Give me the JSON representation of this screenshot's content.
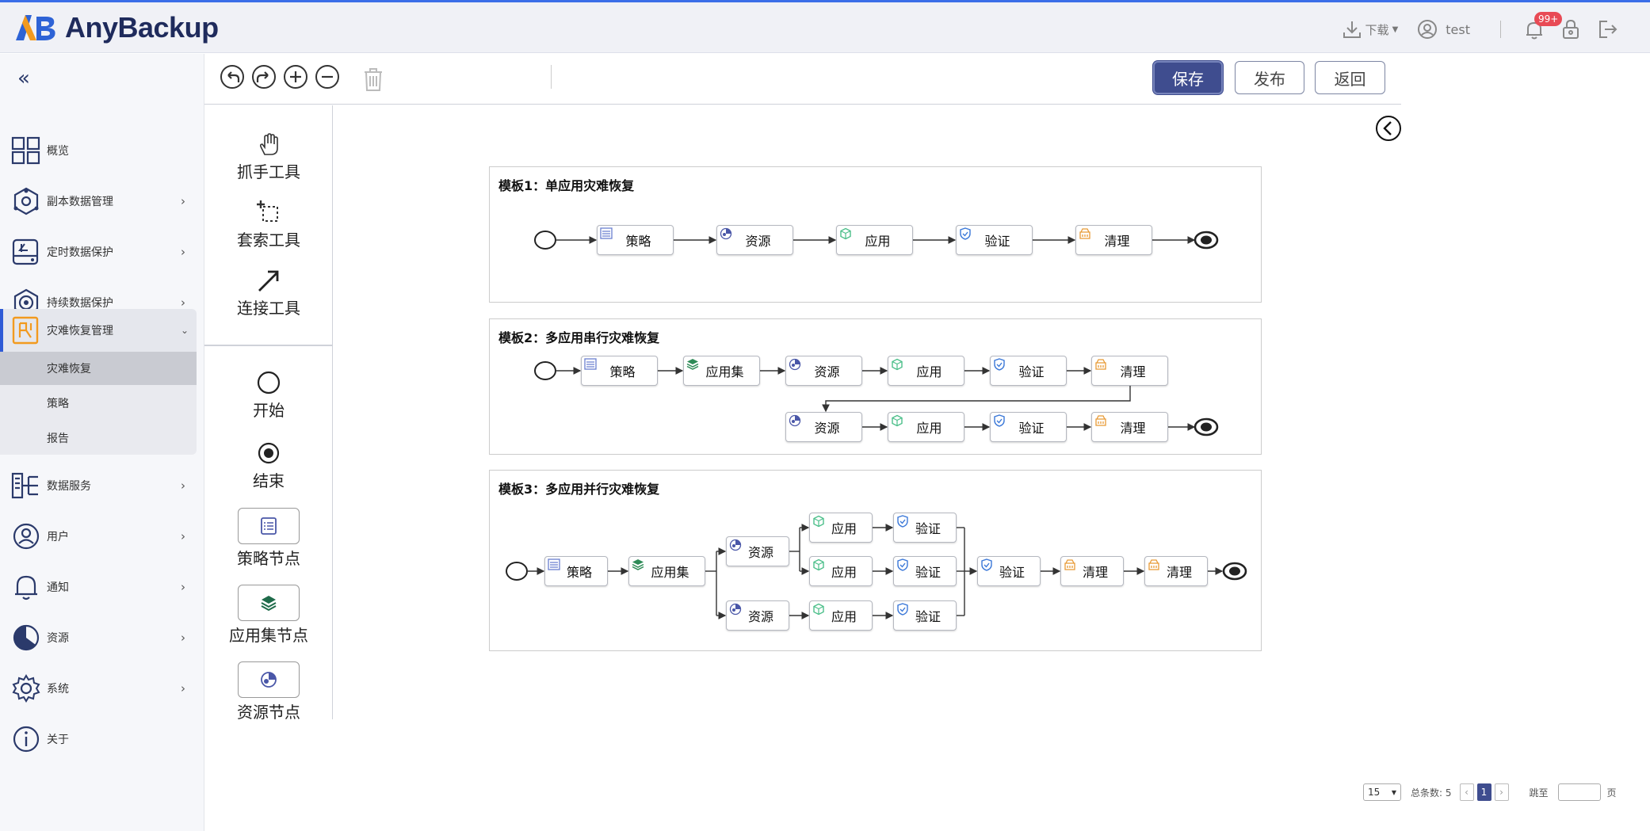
{
  "app": {
    "logo_text": "AnyBackup"
  },
  "header": {
    "download_label": "下载",
    "user_name": "test",
    "notif_badge": "99+"
  },
  "sidebar": {
    "items": [
      {
        "label": "概览",
        "icon": "dashboard-icon",
        "has_children": false
      },
      {
        "label": "副本数据管理",
        "icon": "copy-data-icon",
        "has_children": true
      },
      {
        "label": "定时数据保护",
        "icon": "scheduled-protect-icon",
        "has_children": true
      },
      {
        "label": "持续数据保护",
        "icon": "continuous-protect-icon",
        "has_children": true
      },
      {
        "label": "灾难恢复管理",
        "icon": "disaster-recovery-icon",
        "has_children": true,
        "expanded": true
      },
      {
        "label": "数据服务",
        "icon": "data-service-icon",
        "has_children": true
      },
      {
        "label": "用户",
        "icon": "user-icon",
        "has_children": true
      },
      {
        "label": "通知",
        "icon": "bell-icon",
        "has_children": true
      },
      {
        "label": "资源",
        "icon": "pie-resource-icon",
        "has_children": true
      },
      {
        "label": "系统",
        "icon": "gear-icon",
        "has_children": true
      },
      {
        "label": "关于",
        "icon": "info-icon",
        "has_children": false
      }
    ],
    "sub_items": [
      {
        "label": "灾难恢复",
        "active": true
      },
      {
        "label": "策略",
        "active": false
      },
      {
        "label": "报告",
        "active": false
      }
    ]
  },
  "toolbar": {
    "save_label": "保存",
    "publish_label": "发布",
    "back_label": "返回"
  },
  "palette": {
    "tools": [
      {
        "label": "抓手工具",
        "icon": "hand-icon"
      },
      {
        "label": "套索工具",
        "icon": "lasso-icon"
      },
      {
        "label": "连接工具",
        "icon": "arrow-connect-icon"
      }
    ],
    "nodes": [
      {
        "label": "开始",
        "icon": "start-circle-icon"
      },
      {
        "label": "结束",
        "icon": "end-circle-icon"
      },
      {
        "label": "策略节点",
        "icon": "policy-icon"
      },
      {
        "label": "应用集节点",
        "icon": "layers-icon"
      },
      {
        "label": "资源节点",
        "icon": "resource-icon"
      }
    ]
  },
  "templates": [
    {
      "title": "模板1：单应用灾难恢复"
    },
    {
      "title": "模板2：多应用串行灾难恢复"
    },
    {
      "title": "模板3：多应用并行灾难恢复"
    }
  ],
  "node_labels": {
    "policy": "策略",
    "resource": "资源",
    "app": "应用",
    "verify": "验证",
    "cleanup": "清理",
    "appset": "应用集"
  },
  "pagination": {
    "page_size": "15",
    "total_label": "总条数: 5",
    "current_page": "1",
    "jump_label": "跳至",
    "page_unit": "页"
  },
  "colors": {
    "accent": "#3f4d8f",
    "brand": "#1f2b5c",
    "policy": "#6a7fd0",
    "appset": "#2e8b57",
    "resource": "#4a57a8",
    "app": "#4cbf8a",
    "verify": "#3b78d8",
    "cleanup": "#e89a35"
  }
}
